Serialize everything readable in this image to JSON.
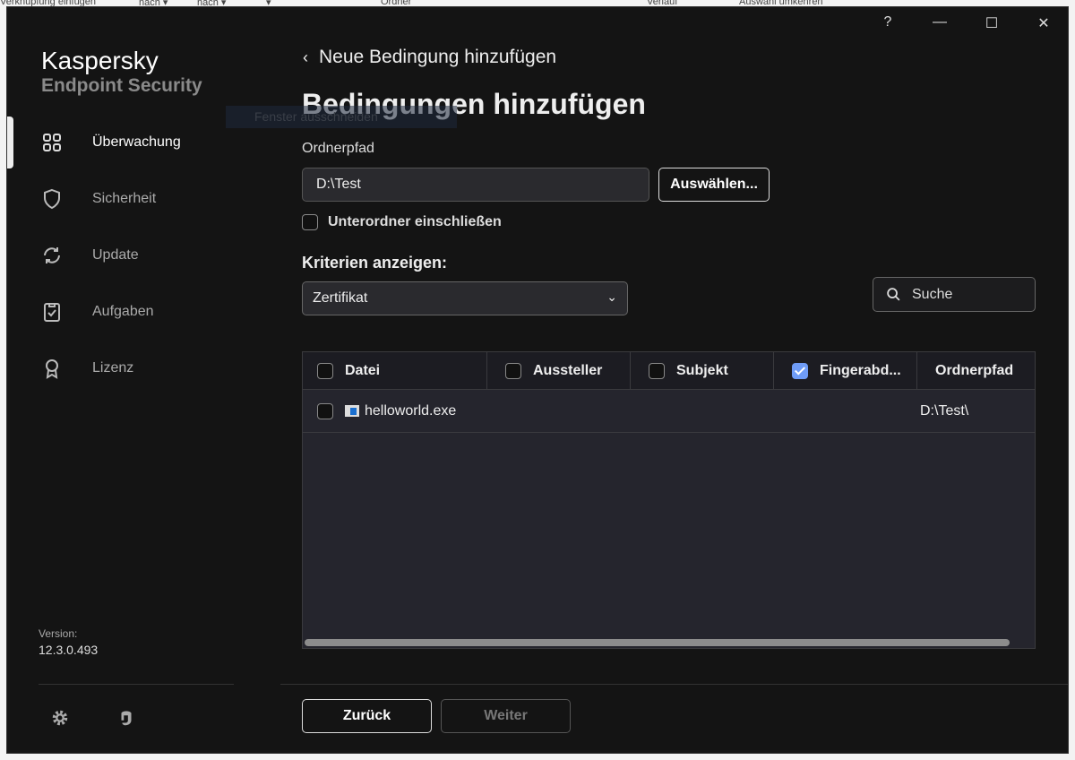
{
  "background": {
    "fragments": [
      "Verknüpfung einfügen",
      "nach ▾",
      "nach ▾",
      "▾",
      "Ordner",
      "Verlauf",
      "Auswahl umkehren"
    ],
    "tooltip": "Fenster ausschneiden"
  },
  "titlebar": {
    "help": "?",
    "minimize": "—",
    "maximize": "☐",
    "close": "✕"
  },
  "sidebar": {
    "brand": "Kaspersky",
    "product": "Endpoint Security",
    "items": [
      {
        "label": "Überwachung",
        "icon": "dashboard-icon"
      },
      {
        "label": "Sicherheit",
        "icon": "shield-icon"
      },
      {
        "label": "Update",
        "icon": "refresh-icon"
      },
      {
        "label": "Aufgaben",
        "icon": "clipboard-icon"
      },
      {
        "label": "Lizenz",
        "icon": "award-icon"
      }
    ],
    "version_label": "Version:",
    "version": "12.3.0.493"
  },
  "main": {
    "back_label": "Neue Bedingung hinzufügen",
    "title": "Bedingungen hinzufügen",
    "folder_label": "Ordnerpfad",
    "folder_value": "D:\\Test",
    "browse_button": "Auswählen...",
    "subfolders_label": "Unterordner einschließen",
    "subfolders_checked": false,
    "criteria_label": "Kriterien anzeigen:",
    "criteria_value": "Zertifikat",
    "search_placeholder": "Suche",
    "table": {
      "columns": [
        {
          "label": "Datei",
          "checked": false
        },
        {
          "label": "Aussteller",
          "checked": false
        },
        {
          "label": "Subjekt",
          "checked": false
        },
        {
          "label": "Fingerabd...",
          "checked": true
        },
        {
          "label": "Ordnerpfad"
        }
      ],
      "rows": [
        {
          "file": "helloworld.exe",
          "folder": "D:\\Test\\",
          "checked": false
        }
      ]
    },
    "back_button": "Zurück",
    "next_button": "Weiter"
  }
}
